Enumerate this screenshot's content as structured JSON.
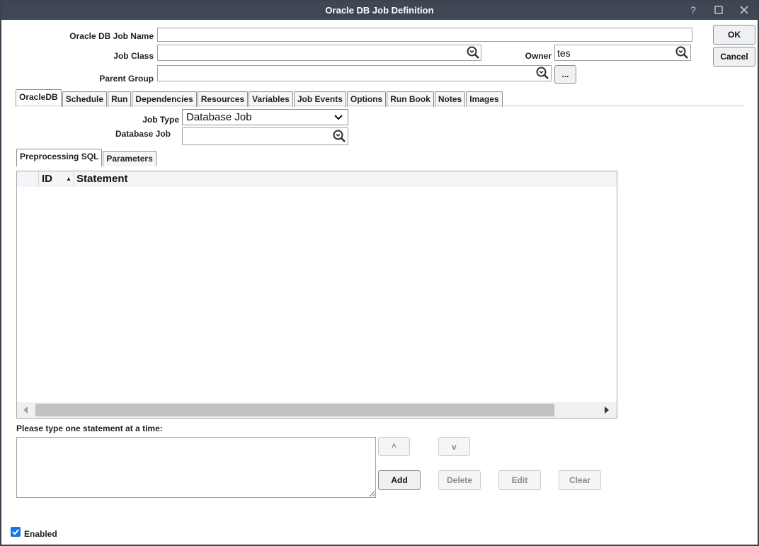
{
  "window": {
    "title": "Oracle DB Job Definition",
    "help_icon": "?",
    "maximize_icon": "□",
    "close_icon": "✕"
  },
  "form": {
    "job_name_label": "Oracle DB Job Name",
    "job_name_value": "",
    "job_class_label": "Job Class",
    "job_class_value": "",
    "owner_label": "Owner",
    "owner_value": "tes",
    "parent_group_label": "Parent Group",
    "parent_group_value": "",
    "ellipsis_label": "..."
  },
  "actions": {
    "ok_label": "OK",
    "cancel_label": "Cancel"
  },
  "tabs": [
    {
      "label": "OracleDB",
      "active": true
    },
    {
      "label": "Schedule"
    },
    {
      "label": "Run"
    },
    {
      "label": "Dependencies"
    },
    {
      "label": "Resources"
    },
    {
      "label": "Variables"
    },
    {
      "label": "Job Events"
    },
    {
      "label": "Options"
    },
    {
      "label": "Run Book"
    },
    {
      "label": "Notes"
    },
    {
      "label": "Images"
    }
  ],
  "oracle": {
    "job_type_label": "Job Type",
    "job_type_value": "Database Job",
    "database_job_label": "Database Job",
    "database_job_value": ""
  },
  "subtabs": [
    {
      "label": "Preprocessing SQL",
      "active": true
    },
    {
      "label": "Parameters"
    }
  ],
  "grid": {
    "columns": [
      "ID",
      "Statement"
    ],
    "sort_indicator": "▲",
    "rows": []
  },
  "statement": {
    "prompt_label": "Please type one statement at a time:",
    "value": "",
    "up_label": "^",
    "down_label": "v",
    "add_label": "Add",
    "delete_label": "Delete",
    "edit_label": "Edit",
    "clear_label": "Clear"
  },
  "footer": {
    "enabled_label": "Enabled",
    "enabled_checked": true
  }
}
